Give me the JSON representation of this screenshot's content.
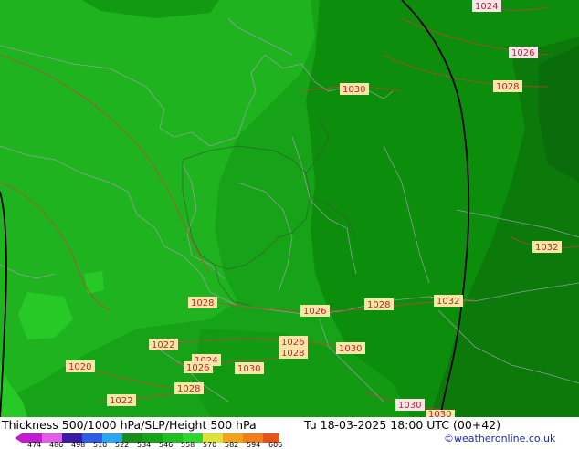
{
  "footer": {
    "title": "Thickness 500/1000 hPa/SLP/Height 500 hPa",
    "time": "Tu 18-03-2025 18:00 UTC (00+42)",
    "credit": "©weatheronline.co.uk"
  },
  "scale": {
    "ticks": [
      "474",
      "486",
      "498",
      "510",
      "522",
      "534",
      "546",
      "558",
      "570",
      "582",
      "594",
      "606"
    ],
    "colors": [
      "#c41bd1",
      "#e35ce6",
      "#3b1aa8",
      "#2f5ce3",
      "#2aa7f0",
      "#1a8c1a",
      "#17a317",
      "#22bd22",
      "#2ed52e",
      "#d9e33a",
      "#f0a21c",
      "#f07e1a",
      "#e8531a"
    ]
  },
  "isobars": [
    {
      "label": "1024"
    },
    {
      "label": "1026"
    },
    {
      "label": "1028"
    },
    {
      "label": "1030"
    },
    {
      "label": "1032"
    },
    {
      "label": "1028"
    },
    {
      "label": "1026"
    },
    {
      "label": "1028"
    },
    {
      "label": "1032"
    },
    {
      "label": "1022"
    },
    {
      "label": "1026"
    },
    {
      "label": "1028"
    },
    {
      "label": "1030"
    },
    {
      "label": "1020"
    },
    {
      "label": "1024"
    },
    {
      "label": "1026"
    },
    {
      "label": "1030"
    },
    {
      "label": "1028"
    },
    {
      "label": "1022"
    },
    {
      "label": "1030"
    },
    {
      "label": "1030"
    }
  ]
}
